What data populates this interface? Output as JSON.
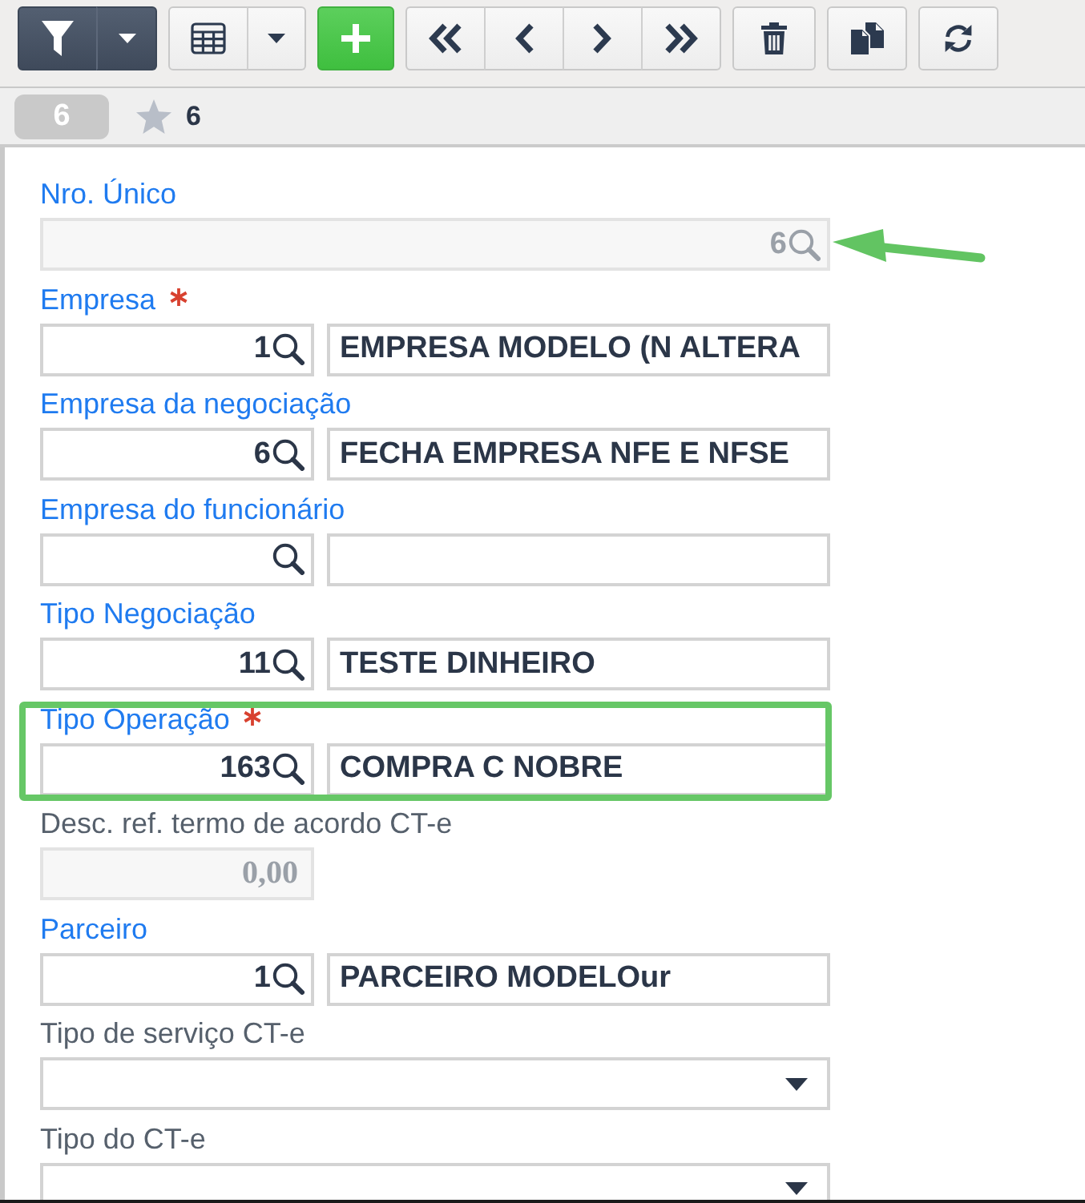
{
  "record_bar": {
    "number": "6",
    "starred": false,
    "count": "6"
  },
  "form": {
    "fields": [
      {
        "kind": "code",
        "label": "Nro. Único",
        "required": false,
        "disabled": true,
        "value": "6",
        "arrow": true,
        "highlighted": false
      },
      {
        "kind": "lookup",
        "label": "Empresa",
        "required": true,
        "disabled": false,
        "code": "1",
        "description": "EMPRESA MODELO (N ALTERA",
        "arrow": false,
        "highlighted": false
      },
      {
        "kind": "lookup",
        "label": "Empresa da negociação",
        "required": false,
        "disabled": false,
        "code": "6",
        "description": "FECHA EMPRESA NFE E NFSE",
        "arrow": false,
        "highlighted": false
      },
      {
        "kind": "lookup",
        "label": "Empresa do funcionário",
        "required": false,
        "disabled": false,
        "arrow": false,
        "highlighted": false
      },
      {
        "kind": "lookup",
        "label": "Tipo Negociação",
        "required": false,
        "disabled": false,
        "code": "11",
        "description": "TESTE DINHEIRO",
        "arrow": false,
        "highlighted": false
      },
      {
        "kind": "lookup",
        "label": "Tipo Operação",
        "required": true,
        "disabled": false,
        "code": "163",
        "description": "COMPRA C NOBRE",
        "arrow": false,
        "highlighted": true
      },
      {
        "kind": "number",
        "label": "Desc. ref. termo de acordo CT-e",
        "required": false,
        "disabled": true,
        "value": "0,00",
        "arrow": false,
        "highlighted": false
      },
      {
        "kind": "lookup",
        "label": "Parceiro",
        "required": false,
        "disabled": false,
        "code": "1",
        "description": "PARCEIRO MODELOur",
        "arrow": false,
        "highlighted": false
      },
      {
        "kind": "select",
        "label": "Tipo de serviço CT-e",
        "required": false,
        "disabled": false,
        "arrow": false,
        "highlighted": false
      },
      {
        "kind": "select",
        "label": "Tipo do CT-e",
        "required": false,
        "disabled": false,
        "arrow": false,
        "highlighted": false
      }
    ]
  }
}
